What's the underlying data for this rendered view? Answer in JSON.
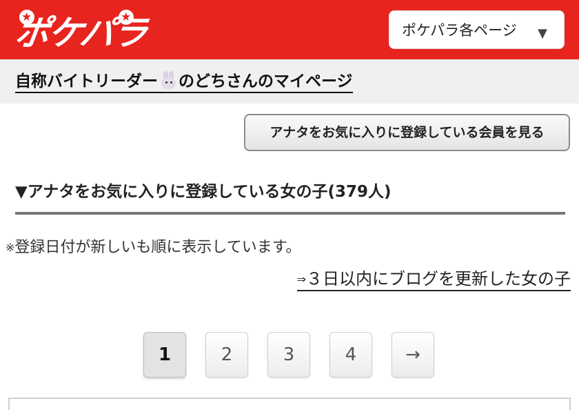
{
  "header": {
    "logo_text": "ポケパラ",
    "page_select_label": "ポケパラ各ページ",
    "page_select_arrow": "▼",
    "colors": {
      "brand_red": "#e8241f"
    }
  },
  "subbar": {
    "mypage_before": "自称バイトリーダー",
    "mypage_icon": "rabbit-icon",
    "mypage_after": "のどちさんのマイページ"
  },
  "members_button": {
    "label": "アナタをお気に入りに登録している会員を見る"
  },
  "section": {
    "title": "▼アナタをお気に入りに登録している女の子(379人)",
    "note_mark": "※",
    "note": "登録日付が新しいも順に表示しています。",
    "blog_link_mark": "⇒",
    "blog_link": "３日以内にブログを更新した女の子"
  },
  "pagination": {
    "pages": [
      "1",
      "2",
      "3",
      "4"
    ],
    "current": "1",
    "next": "→"
  }
}
